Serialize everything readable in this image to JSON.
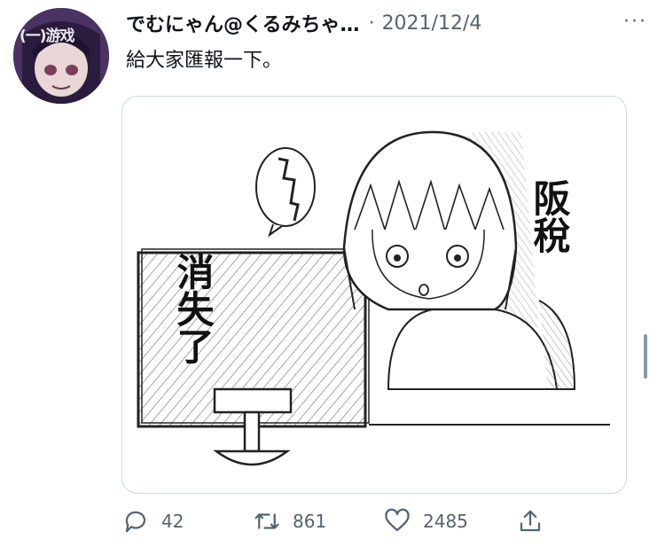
{
  "watermark": "(一)游戏",
  "tweet": {
    "display_name": "でむにゃん@くるみちゃ…",
    "separator": "·",
    "date": "2021/12/4",
    "more_label": "···",
    "text": "給大家匯報一下。"
  },
  "media": {
    "caption_left": "消失了",
    "caption_right": "阪稅"
  },
  "actions": {
    "reply_count": "42",
    "retweet_count": "861",
    "like_count": "2485"
  },
  "icons": {
    "reply": "reply-icon",
    "retweet": "retweet-icon",
    "like": "heart-icon",
    "share": "share-icon"
  }
}
